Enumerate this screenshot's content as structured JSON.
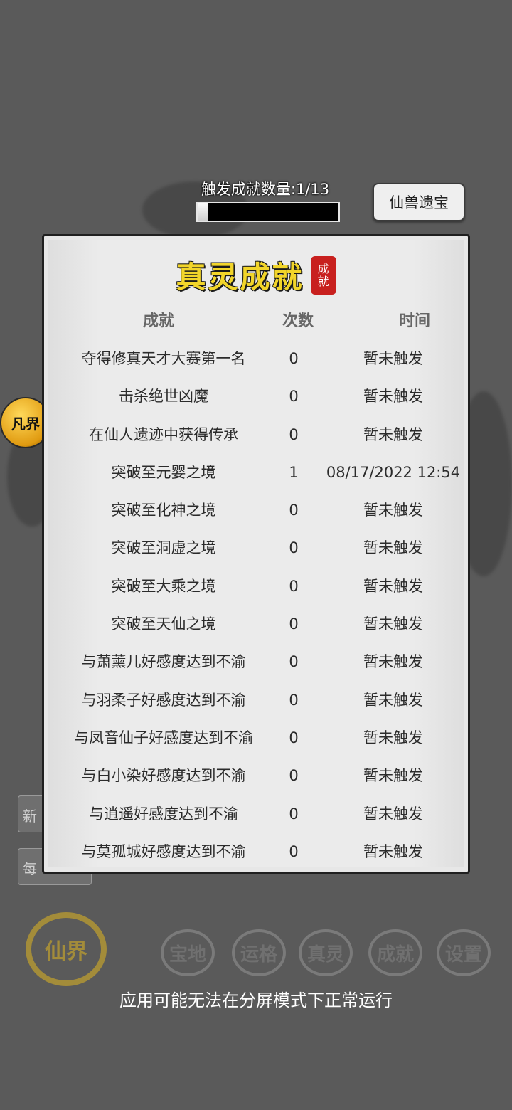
{
  "header": {
    "counter_label": "触发成就数量:1/13",
    "progress": 0.077,
    "button_label": "仙兽遗宝"
  },
  "side_badge": {
    "label": "凡界"
  },
  "hidden_buttons": {
    "first": "新",
    "second": "每"
  },
  "panel": {
    "title": "真灵成就",
    "seal_text": "成就",
    "columns": {
      "name": "成就",
      "count": "次数",
      "time": "时间"
    },
    "rows": [
      {
        "name": "夺得修真天才大赛第一名",
        "count": "0",
        "time": "暂未触发"
      },
      {
        "name": "击杀绝世凶魔",
        "count": "0",
        "time": "暂未触发"
      },
      {
        "name": "在仙人遗迹中获得传承",
        "count": "0",
        "time": "暂未触发"
      },
      {
        "name": "突破至元婴之境",
        "count": "1",
        "time": "08/17/2022 12:54"
      },
      {
        "name": "突破至化神之境",
        "count": "0",
        "time": "暂未触发"
      },
      {
        "name": "突破至洞虚之境",
        "count": "0",
        "time": "暂未触发"
      },
      {
        "name": "突破至大乘之境",
        "count": "0",
        "time": "暂未触发"
      },
      {
        "name": "突破至天仙之境",
        "count": "0",
        "time": "暂未触发"
      },
      {
        "name": "与萧薰儿好感度达到不渝",
        "count": "0",
        "time": "暂未触发"
      },
      {
        "name": "与羽柔子好感度达到不渝",
        "count": "0",
        "time": "暂未触发"
      },
      {
        "name": "与凤音仙子好感度达到不渝",
        "count": "0",
        "time": "暂未触发"
      },
      {
        "name": "与白小染好感度达到不渝",
        "count": "0",
        "time": "暂未触发"
      },
      {
        "name": "与逍遥好感度达到不渝",
        "count": "0",
        "time": "暂未触发"
      },
      {
        "name": "与莫孤城好感度达到不渝",
        "count": "0",
        "time": "暂未触发"
      }
    ]
  },
  "bottom_nav": {
    "main": "仙界",
    "items": [
      "宝地",
      "运格",
      "真灵",
      "成就",
      "设置"
    ]
  },
  "toast": "应用可能无法在分屏模式下正常运行"
}
